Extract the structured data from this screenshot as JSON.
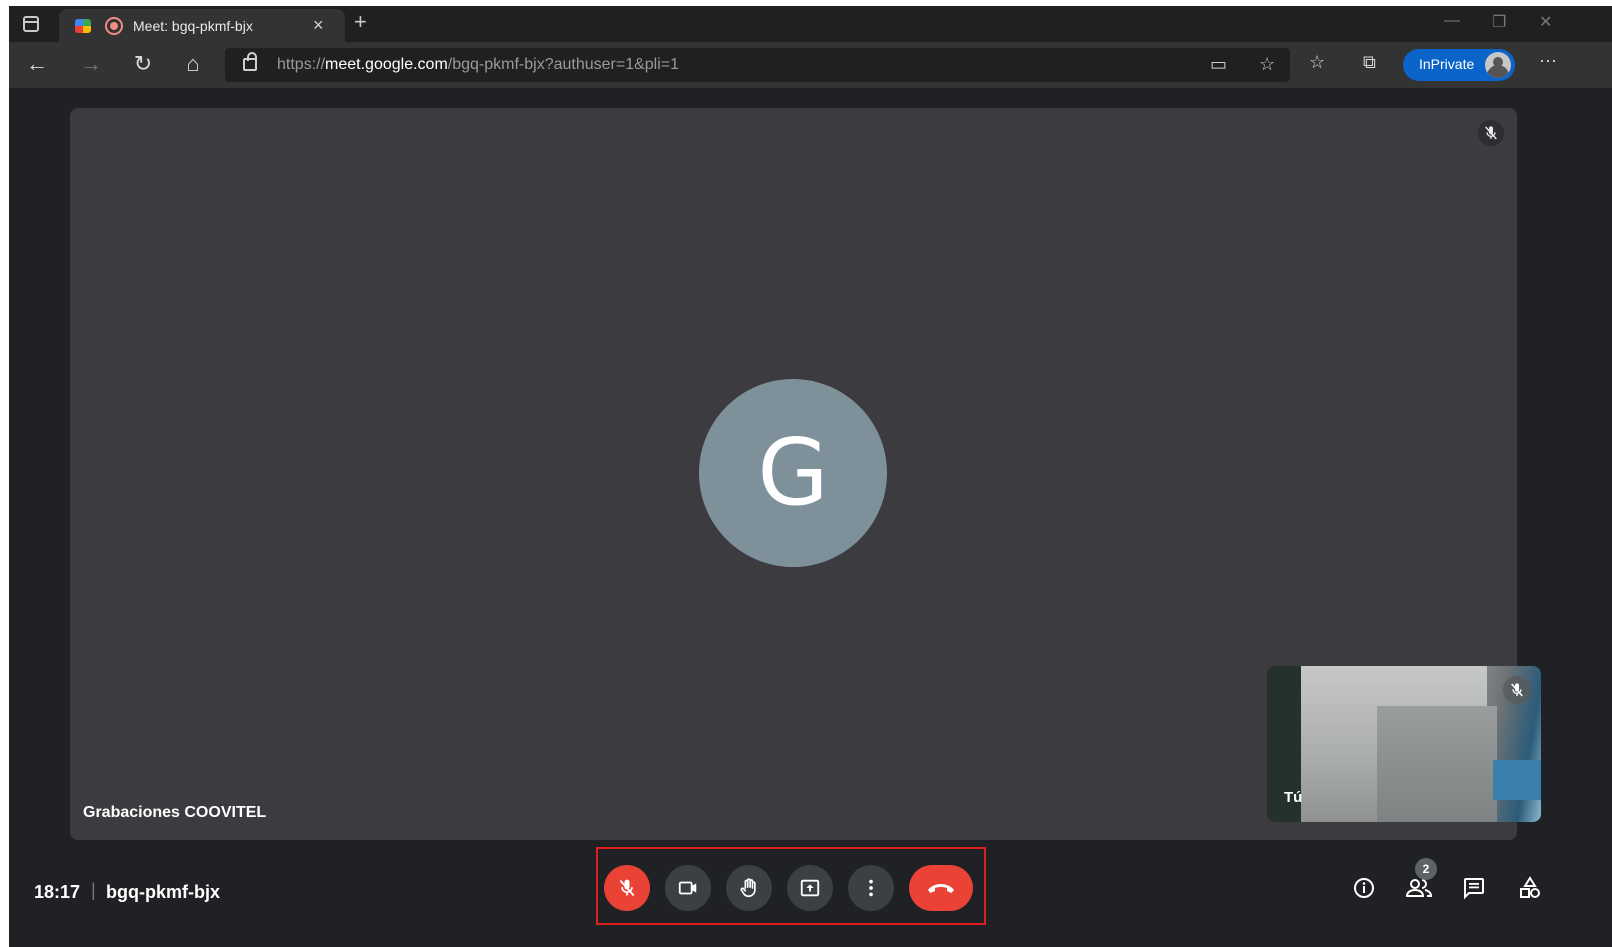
{
  "browser": {
    "tab_title": "Meet: bgq-pkmf-bjx",
    "tab_close": "×",
    "new_tab": "+",
    "url_scheme": "https://",
    "url_host": "meet.google.com",
    "url_path": "/bgq-pkmf-bjx?authuser=1&pli=1",
    "inprivate_label": "InPrivate",
    "more": "···"
  },
  "meeting": {
    "main_participant_initial": "G",
    "main_participant_name": "Grabaciones COOVITEL",
    "self_name": "Tú",
    "time": "18:17",
    "separator": "|",
    "code": "bgq-pkmf-bjx",
    "participant_count": "2"
  },
  "colors": {
    "end_call": "#ea4335",
    "mic_off": "#ea4335",
    "avatar": "#7e919b",
    "highlight_frame": "#e02020"
  },
  "icons": {
    "controls": [
      "mic-off-icon",
      "camera-icon",
      "raise-hand-icon",
      "present-screen-icon",
      "more-options-icon",
      "end-call-icon"
    ],
    "right": [
      "info-icon",
      "people-icon",
      "chat-icon",
      "activities-icon"
    ]
  }
}
